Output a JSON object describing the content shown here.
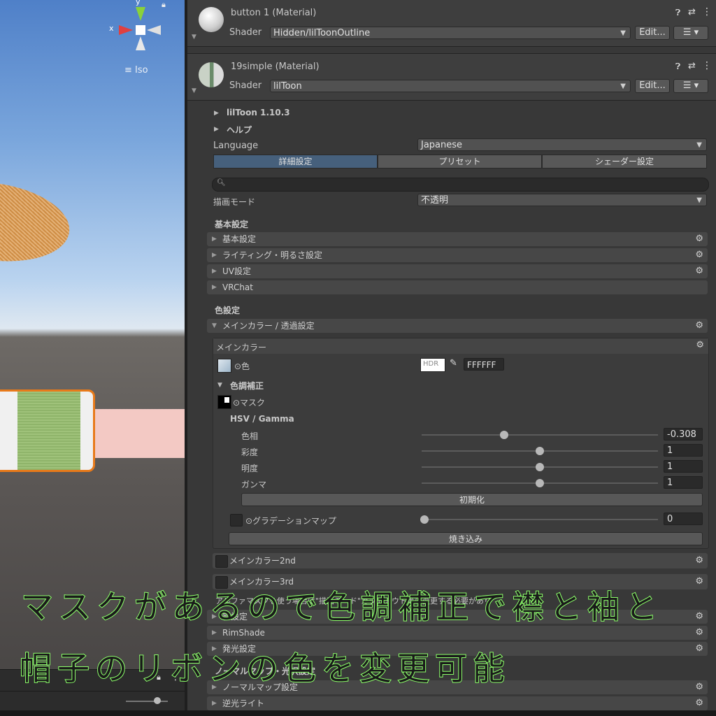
{
  "scene": {
    "axis_y": "y",
    "axis_x": "x",
    "iso_label": "Iso",
    "lock_icon": "lock-icon",
    "menu_icon": "kebab-icon"
  },
  "materials": [
    {
      "title": "button 1 (Material)",
      "shader_label": "Shader",
      "shader": "Hidden/lilToonOutline",
      "edit_label": "Edit..."
    },
    {
      "title": "19simple (Material)",
      "shader_label": "Shader",
      "shader": "lilToon",
      "edit_label": "Edit..."
    }
  ],
  "liltoon": {
    "version": "lilToon 1.10.3",
    "help": "ヘルプ",
    "language_label": "Language",
    "language_value": "Japanese",
    "tabs": [
      {
        "label": "詳細設定",
        "selected": true
      },
      {
        "label": "プリセット",
        "selected": false
      },
      {
        "label": "シェーダー設定",
        "selected": false
      }
    ],
    "search_placeholder": "",
    "render_mode_label": "描画モード",
    "render_mode_value": "不透明",
    "section_basic": "基本設定",
    "basic_items": [
      "基本設定",
      "ライティング・明るさ設定",
      "UV設定",
      "VRChat"
    ],
    "section_color": "色設定",
    "main_color_foldout": "メインカラー / 透過設定",
    "main_color_box_title": "メインカラー",
    "color_label": "⊙色",
    "hdr_label": "HDR",
    "color_hex": "FFFFFF",
    "tone_title": "色調補正",
    "mask_label": "⊙マスク",
    "hsv_title": "HSV / Gamma",
    "hsv": [
      {
        "label": "色相",
        "value": "-0.308",
        "fraction": 0.35
      },
      {
        "label": "彩度",
        "value": "1",
        "fraction": 0.5
      },
      {
        "label": "明度",
        "value": "1",
        "fraction": 0.5
      },
      {
        "label": "ガンマ",
        "value": "1",
        "fraction": 0.5
      }
    ],
    "reset_label": "初期化",
    "gradation_label": "⊙グラデーションマップ",
    "gradation_value": "0",
    "bake_label": "焼き込み",
    "main2_label": "メインカラー2nd",
    "main3_label": "メインカラー3rd",
    "alpha_note": "アルファマスクを使う場合は\"描画モード\"カットアウト等に変更する必要があり",
    "other_items": [
      "影設定",
      "RimShade",
      "発光設定"
    ],
    "normal_section": "ノーマルマップ・光沢設定",
    "normal_items": [
      "ノーマルマップ設定",
      "逆光ライト"
    ]
  },
  "annotation": {
    "line1": "マスクがあるので色調補正で襟と袖と",
    "line2": "帽子のリボンの色を変更可能",
    "color": "#8cff6a"
  }
}
